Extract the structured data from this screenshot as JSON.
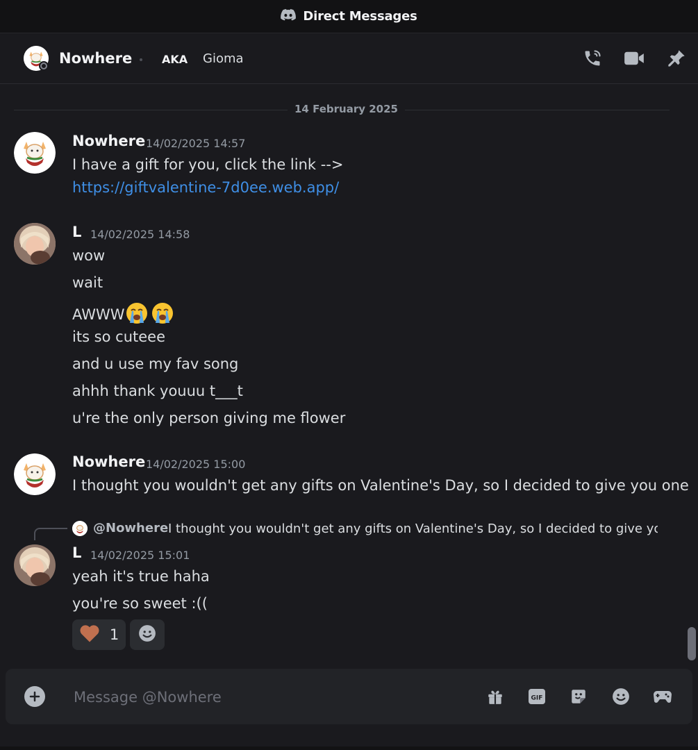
{
  "window": {
    "title": "Direct Messages"
  },
  "header": {
    "name": "Nowhere",
    "aka_label": "AKA",
    "aka_name": "Gioma",
    "icons": [
      "phone-call-icon",
      "video-camera-icon",
      "pin-icon"
    ]
  },
  "divider": {
    "date": "14 February 2025"
  },
  "messages": [
    {
      "author": "Nowhere",
      "timestamp": "14/02/2025 14:57",
      "lines": [
        "I have a gift for you, click the link -->"
      ],
      "link": "https://giftvalentine-7d0ee.web.app/"
    },
    {
      "author": "L",
      "timestamp": "14/02/2025 14:58",
      "lines": [
        "wow",
        "wait",
        "AWWW",
        "its so cuteee",
        "and u use my fav song",
        "ahhh thank youuu t___t",
        "u're the only person giving me flower"
      ]
    },
    {
      "author": "Nowhere",
      "timestamp": "14/02/2025 15:00",
      "lines": [
        "I thought you wouldn't get any gifts on Valentine's Day, so I decided to give you one"
      ]
    },
    {
      "author": "L",
      "timestamp": "14/02/2025 15:01",
      "reply": {
        "user": "@Nowhere",
        "text": "I thought you wouldn't get any gifts on Valentine's Day, so I decided to give you..."
      },
      "lines": [
        "yeah it's true haha",
        "you're so sweet :(("
      ],
      "reactions": [
        {
          "emoji": "heart",
          "count": "1"
        }
      ]
    }
  ],
  "composer": {
    "placeholder": "Message @Nowhere",
    "icons": [
      "gift-icon",
      "gif-icon",
      "sticker-icon",
      "emoji-icon",
      "game-controller-icon"
    ],
    "gif_label": "GIF"
  },
  "colors": {
    "background": "#1a1a1e",
    "link": "#3f8fe6",
    "heart": "#c0704f"
  }
}
